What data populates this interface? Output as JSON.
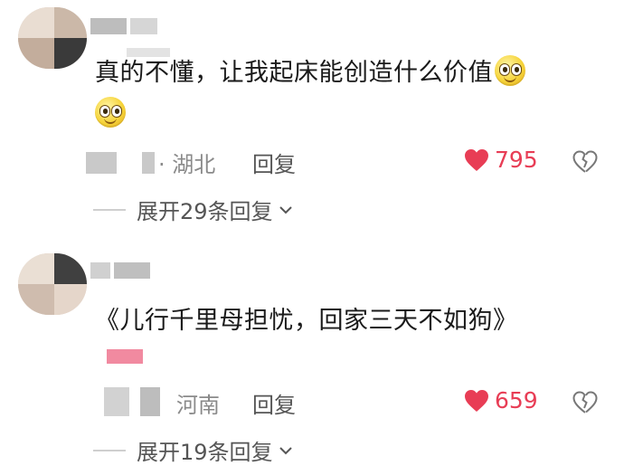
{
  "comments": [
    {
      "text": "真的不懂，让我起床能创造什么价值",
      "location": "· 湖北",
      "reply_label": "回复",
      "likes": "795",
      "expand_label": "展开29条回复"
    },
    {
      "text": "《儿行千里母担忧，回家三天不如狗》",
      "location": "河南",
      "reply_label": "回复",
      "likes": "659",
      "expand_label": "展开19条回复"
    }
  ],
  "colors": {
    "like": "#e83d55",
    "muted": "#8a8a8a"
  },
  "icons": [
    "heart-icon",
    "broken-heart-icon",
    "chevron-down-icon",
    "smiley-emoji-icon"
  ]
}
